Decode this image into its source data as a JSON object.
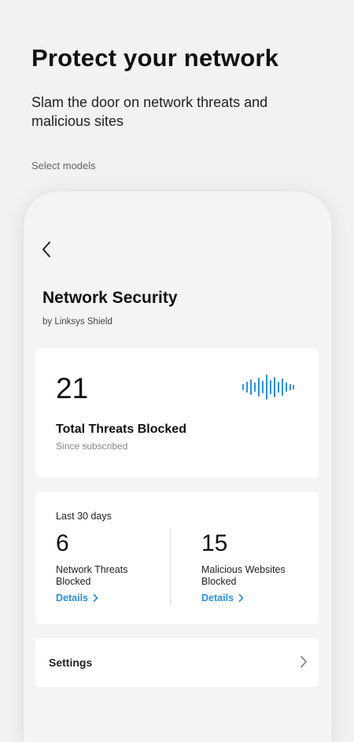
{
  "hero": {
    "title": "Protect your network",
    "subtitle": "Slam the door on network threats and malicious sites",
    "note": "Select models"
  },
  "screen": {
    "title": "Network Security",
    "subtitle": "by Linksys Shield",
    "back_icon": "chevron-left-icon",
    "total": {
      "count": "21",
      "label": "Total Threats Blocked",
      "since": "Since subscribed",
      "icon": "sound-wave-icon"
    },
    "period": {
      "label": "Last 30 days",
      "network": {
        "count": "6",
        "label": "Network Threats Blocked",
        "details": "Details"
      },
      "websites": {
        "count": "15",
        "label": "Malicious Websites Blocked",
        "details": "Details"
      }
    },
    "settings": {
      "label": "Settings"
    }
  },
  "colors": {
    "accent": "#2d8fe0",
    "background": "#f2f2f2",
    "card": "#ffffff"
  }
}
